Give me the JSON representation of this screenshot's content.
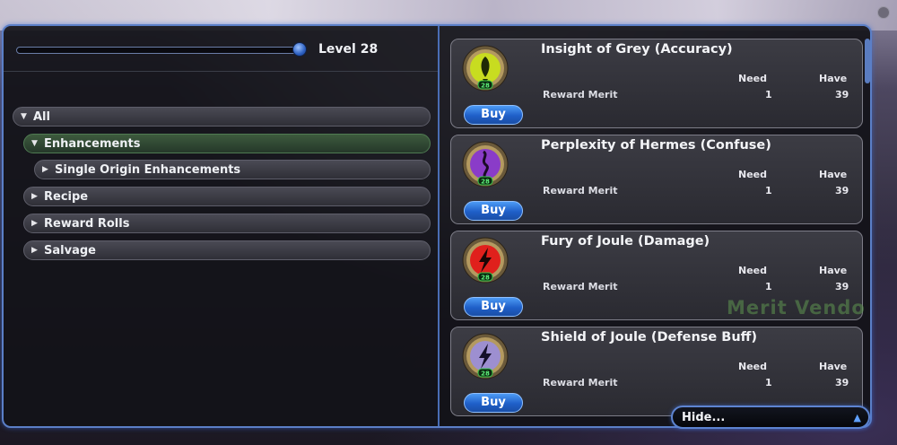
{
  "level": {
    "label": "Level 28",
    "slider_fraction": 1.0
  },
  "tree": {
    "items": [
      {
        "label": "All",
        "expanded": true
      },
      {
        "label": "Enhancements",
        "expanded": true,
        "selected": true
      },
      {
        "label": "Single Origin Enhancements",
        "expanded": false
      },
      {
        "label": "Recipe",
        "expanded": false
      },
      {
        "label": "Reward Rolls",
        "expanded": false
      },
      {
        "label": "Salvage",
        "expanded": false
      }
    ]
  },
  "store": {
    "need_header": "Need",
    "have_header": "Have",
    "buy_label": "Buy",
    "items": [
      {
        "title": "Insight of Grey (Accuracy)",
        "cost_name": "Reward Merit",
        "need": "1",
        "have": "39",
        "icon": "accuracy-enhancement-icon",
        "icon_color": "#c8dc20",
        "level_badge": "28"
      },
      {
        "title": "Perplexity of Hermes (Confuse)",
        "cost_name": "Reward Merit",
        "need": "1",
        "have": "39",
        "icon": "confuse-enhancement-icon",
        "icon_color": "#8a3cc8",
        "level_badge": "28"
      },
      {
        "title": "Fury of Joule (Damage)",
        "cost_name": "Reward Merit",
        "need": "1",
        "have": "39",
        "icon": "damage-enhancement-icon",
        "icon_color": "#e0201c",
        "level_badge": "28"
      },
      {
        "title": "Shield of Joule (Defense Buff)",
        "cost_name": "Reward Merit",
        "need": "1",
        "have": "39",
        "icon": "defense-buff-enhancement-icon",
        "icon_color": "#9d8fd0",
        "level_badge": "28"
      }
    ]
  },
  "watermark": "Merit Vendo",
  "hide": {
    "label": "Hide..."
  },
  "colors": {
    "accent": "#4a7dd6",
    "buy_button": "#2f73d8",
    "selected_row": "#3d5a3d"
  }
}
